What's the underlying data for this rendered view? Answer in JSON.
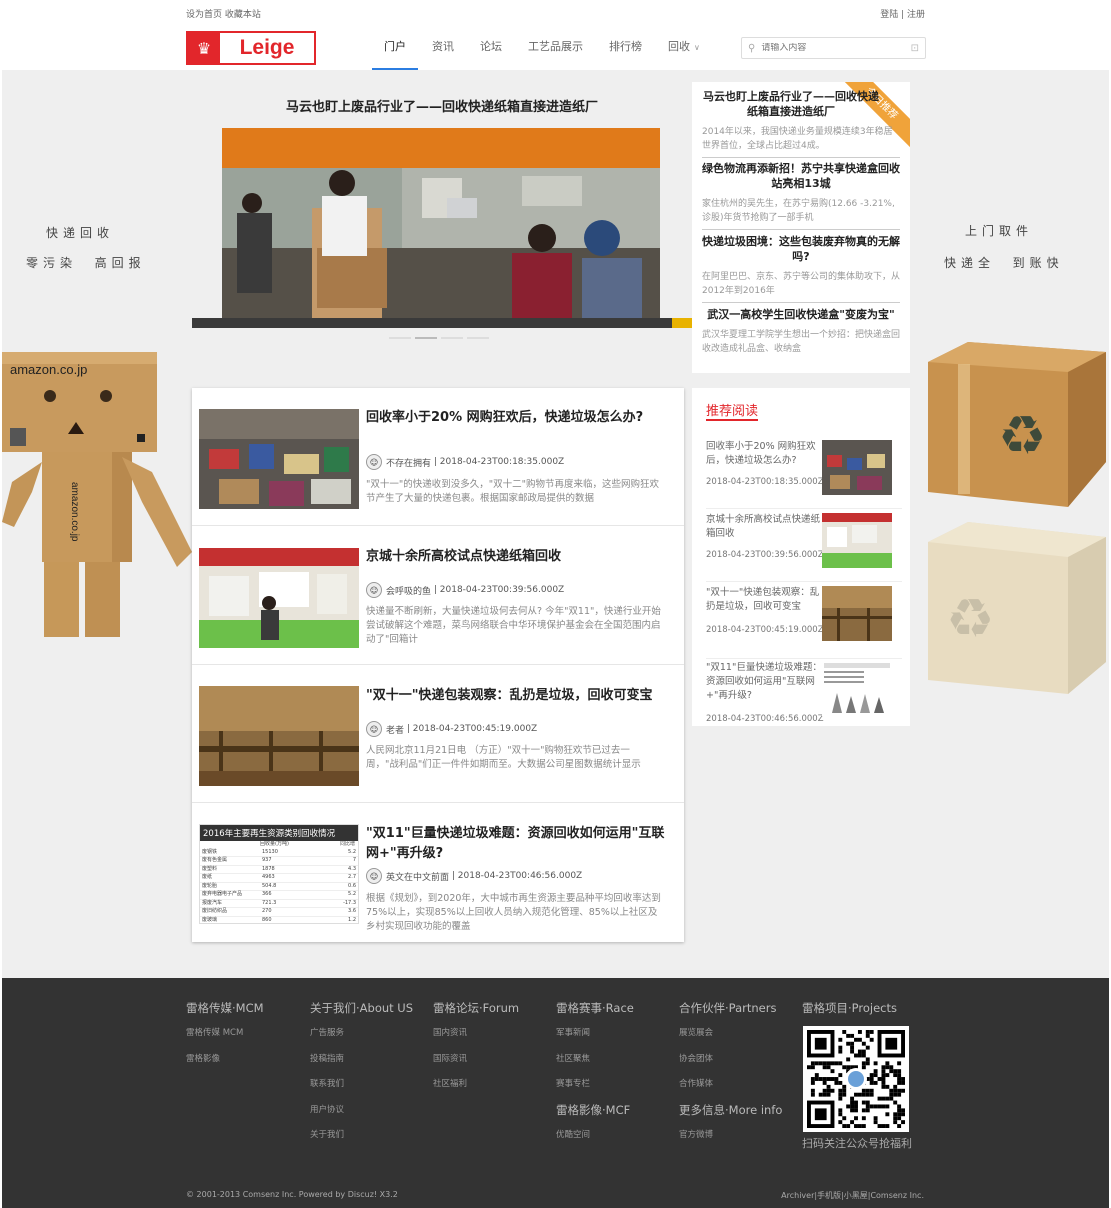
{
  "topbar": {
    "set_home": "设为首页",
    "bookmark": "收藏本站",
    "login_register": "登陆 | 注册"
  },
  "logo": {
    "text": "Leige"
  },
  "nav": {
    "items": [
      "门户",
      "资讯",
      "论坛",
      "工艺品展示",
      "排行榜",
      "回收"
    ],
    "active": "门户"
  },
  "search": {
    "placeholder": "请输入内容"
  },
  "side_slogans": {
    "left_1": "快递回收",
    "left_2": "零污染  高回报",
    "right_1": "上门取件",
    "right_2": "快递全  到账快"
  },
  "hero": {
    "title": "马云也盯上废品行业了——回收快递纸箱直接进造纸厂"
  },
  "hot_list": {
    "ribbon": "今日推荐",
    "items": [
      {
        "title": "马云也盯上废品行业了——回收快递纸箱直接进造纸厂",
        "desc": "2014年以来，我国快递业务量规模连续3年稳居世界首位，全球占比超过4成。"
      },
      {
        "title": "绿色物流再添新招！苏宁共享快递盒回收站亮相13城",
        "desc": "家住杭州的吴先生，在苏宁易购(12.66 -3.21%,诊股)年货节抢购了一部手机"
      },
      {
        "title": "快递垃圾困境：这些包装废弃物真的无解吗?",
        "desc": "在阿里巴巴、京东、苏宁等公司的集体助攻下，从2012年到2016年"
      },
      {
        "title": "武汉一高校学生回收快递盒\"变废为宝\"",
        "desc": "武汉华夏理工学院学生想出一个妙招：把快递盒回收改造成礼品盒、收纳盒"
      }
    ]
  },
  "articles": [
    {
      "title": "回收率小于20% 网购狂欢后，快递垃圾怎么办?",
      "author": "不存在拥有",
      "date": "2018-04-23T00:18:35.000Z",
      "desc": "\"双十一\"的快递收到没多久，\"双十二\"购物节再度来临，这些网购狂欢节产生了大量的快递包裹。根据国家邮政局提供的数据"
    },
    {
      "title": "京城十余所高校试点快递纸箱回收",
      "author": "会呼吸的鱼",
      "date": "2018-04-23T00:39:56.000Z",
      "desc": "快递量不断刷新，大量快递垃圾何去何从? 今年\"双11\"，快递行业开始尝试破解这个难题，菜鸟网络联合中华环境保护基金会在全国范围内启动了\"回箱计"
    },
    {
      "title": "\"双十一\"快递包装观察：乱扔是垃圾，回收可变宝",
      "author": "老者",
      "date": "2018-04-23T00:45:19.000Z",
      "desc": "人民网北京11月21日电 （方正）\"双十一\"购物狂欢节已过去一周，\"战利品\"们正一件件如期而至。大数据公司星图数据统计显示"
    },
    {
      "title": "\"双11\"巨量快递垃圾难题：资源回收如何运用\"互联网+\"再升级?",
      "author": "英文在中文前面",
      "date": "2018-04-23T00:46:56.000Z",
      "desc": "根据《规划》，到2020年，大中城市再生资源主要品种平均回收率达到75%以上，实现85%以上回收人员纳入规范化管理、85%以上社区及乡村实现回收功能的覆盖",
      "thumb_table": {
        "heading": "2016年主要再生资源类别回收情况",
        "col1": "回收量(万吨)",
        "col2": "同比增",
        "rows": [
          [
            "废钢铁",
            "15130",
            "5.2"
          ],
          [
            "废有色金属",
            "937",
            "7"
          ],
          [
            "废塑料",
            "1878",
            "4.3"
          ],
          [
            "废纸",
            "4963",
            "2.7"
          ],
          [
            "废轮胎",
            "504.8",
            "0.6"
          ],
          [
            "废弃电器电子产品",
            "366",
            "5.2"
          ],
          [
            "报废汽车",
            "721.3",
            "-17.3"
          ],
          [
            "废旧纺织品",
            "270",
            "3.6"
          ],
          [
            "废玻璃",
            "860",
            "1.2"
          ]
        ]
      }
    }
  ],
  "recommend": {
    "heading": "推荐阅读",
    "items": [
      {
        "title": "回收率小于20% 网购狂欢后，快递垃圾怎么办?",
        "date": "2018-04-23T00:18:35.000Z"
      },
      {
        "title": "京城十余所高校试点快递纸箱回收",
        "date": "2018-04-23T00:39:56.000Z"
      },
      {
        "title": "\"双十一\"快递包装观察：乱扔是垃圾，回收可变宝",
        "date": "2018-04-23T00:45:19.000Z"
      },
      {
        "title": "\"双11\"巨量快递垃圾难题：资源回收如何运用\"互联网+\"再升级?",
        "date": "2018-04-23T00:46:56.000Z"
      }
    ]
  },
  "footer": {
    "cols": [
      {
        "heading": "雷格传媒·MCM",
        "links": [
          "雷格传媒 MCM",
          "雷格影像"
        ]
      },
      {
        "heading": "关于我们·About US",
        "links": [
          "广告服务",
          "投稿指南",
          "联系我们",
          "用户协议",
          "关于我们"
        ]
      },
      {
        "heading": "雷格论坛·Forum",
        "links": [
          "国内资讯",
          "国际资讯",
          "社区福利"
        ]
      },
      {
        "heading": "雷格赛事·Race",
        "links": [
          "军事新闻",
          "社区聚焦",
          "赛事专栏"
        ]
      },
      {
        "heading": "合作伙伴·Partners",
        "links": [
          "展览展会",
          "协会团体",
          "合作媒体"
        ]
      },
      {
        "heading": "雷格项目·Projects",
        "links": []
      }
    ],
    "extra_cols": [
      {
        "heading": "雷格影像·MCF",
        "links": [
          "优酷空间"
        ]
      },
      {
        "heading": "更多信息·More info",
        "links": [
          "官方微博"
        ]
      }
    ],
    "qr_caption": "扫码关注公众号抢福利",
    "copyright": "© 2001-2013 Comsenz Inc. Powered by Discuz! X3.2",
    "right_links": "Archiver|手机版|小黑屋|Comsenz Inc."
  },
  "colors": {
    "brand_red": "#e2262b",
    "nav_active": "#2b7de1",
    "ribbon": "#f0a33a",
    "footer_bg": "#333333"
  }
}
